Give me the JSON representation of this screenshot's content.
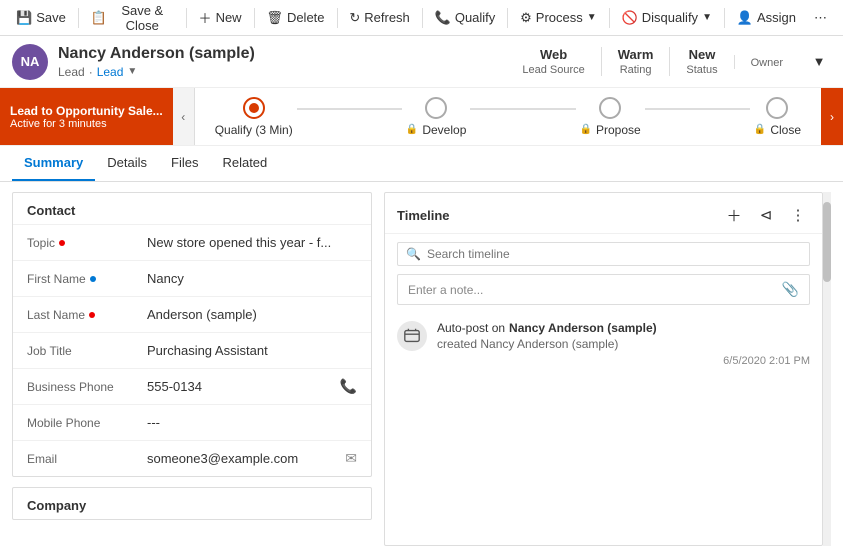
{
  "toolbar": {
    "save_label": "Save",
    "save_close_label": "Save & Close",
    "new_label": "New",
    "delete_label": "Delete",
    "refresh_label": "Refresh",
    "qualify_label": "Qualify",
    "process_label": "Process",
    "disqualify_label": "Disqualify",
    "assign_label": "Assign",
    "more_label": "⋯"
  },
  "header": {
    "avatar_initials": "NA",
    "name": "Nancy Anderson (sample)",
    "type": "Lead",
    "type_link": "Lead",
    "meta": [
      {
        "value": "Web",
        "label": "Lead Source"
      },
      {
        "value": "Warm",
        "label": "Rating"
      },
      {
        "value": "New",
        "label": "Status"
      },
      {
        "value": "",
        "label": "Owner"
      }
    ]
  },
  "process": {
    "alert_title": "Lead to Opportunity Sale...",
    "alert_sub": "Active for 3 minutes",
    "steps": [
      {
        "label": "Qualify (3 Min)",
        "active": true,
        "locked": false
      },
      {
        "label": "Develop",
        "active": false,
        "locked": true
      },
      {
        "label": "Propose",
        "active": false,
        "locked": true
      },
      {
        "label": "Close",
        "active": false,
        "locked": true
      }
    ]
  },
  "tabs": [
    {
      "label": "Summary",
      "active": true
    },
    {
      "label": "Details",
      "active": false
    },
    {
      "label": "Files",
      "active": false
    },
    {
      "label": "Related",
      "active": false
    }
  ],
  "contact_section": {
    "title": "Contact",
    "fields": [
      {
        "label": "Topic",
        "required": true,
        "value": "New store opened this year - f...",
        "icon": ""
      },
      {
        "label": "First Name",
        "required": false,
        "optional": true,
        "value": "Nancy",
        "icon": ""
      },
      {
        "label": "Last Name",
        "required": true,
        "value": "Anderson (sample)",
        "icon": ""
      },
      {
        "label": "Job Title",
        "required": false,
        "value": "Purchasing Assistant",
        "icon": ""
      },
      {
        "label": "Business Phone",
        "required": false,
        "value": "555-0134",
        "icon": "📞"
      },
      {
        "label": "Mobile Phone",
        "required": false,
        "value": "---",
        "icon": ""
      },
      {
        "label": "Email",
        "required": false,
        "value": "someone3@example.com",
        "icon": "✉"
      }
    ]
  },
  "company_section": {
    "title": "Company"
  },
  "timeline": {
    "title": "Timeline",
    "search_placeholder": "Search timeline",
    "note_placeholder": "Enter a note...",
    "entries": [
      {
        "avatar": "🔄",
        "type": "auto-post",
        "title_prefix": "Auto-post on ",
        "title_bold": "Nancy Anderson (sample)",
        "sub": "created Nancy Anderson (sample)",
        "date": "6/5/2020 2:01 PM"
      }
    ]
  }
}
